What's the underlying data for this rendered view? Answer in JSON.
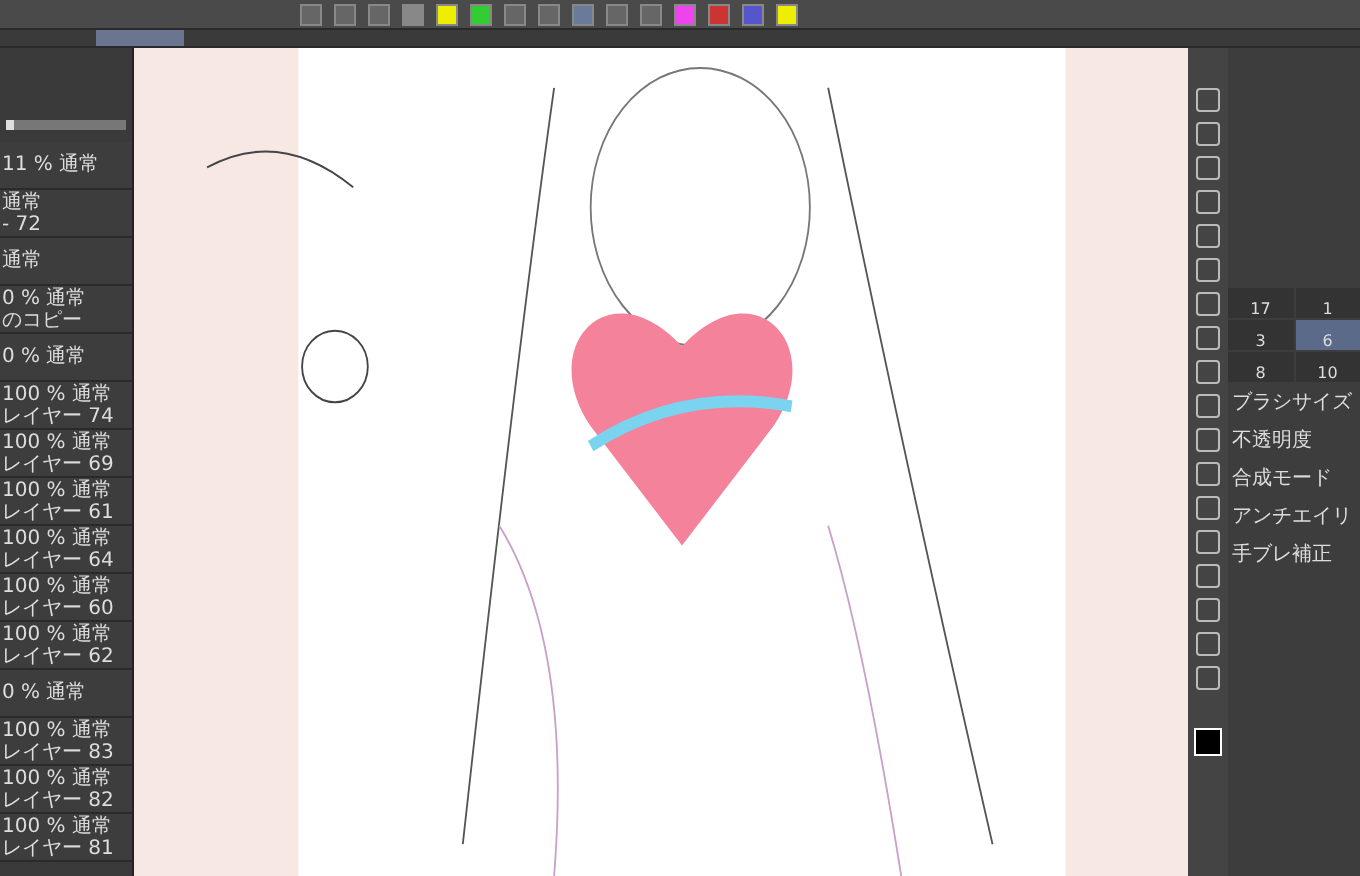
{
  "layer_panel": {
    "opacity_slider": {
      "level": 0.06
    },
    "layers": [
      {
        "line1": "11 % 通常",
        "selected": false
      },
      {
        "line1": "通常",
        "line2": "- 72",
        "selected": false
      },
      {
        "line1": "通常",
        "selected": false
      },
      {
        "line1": "0 % 通常",
        "line2": "のコピー",
        "selected": false
      },
      {
        "line1": "0 % 通常",
        "selected": false
      },
      {
        "line1": "100 % 通常",
        "line2": "レイヤー 74",
        "selected": false
      },
      {
        "line1": "100 % 通常",
        "line2": "レイヤー 69",
        "selected": false
      },
      {
        "line1": "100 % 通常",
        "line2": "レイヤー 61",
        "selected": false
      },
      {
        "line1": "100 % 通常",
        "line2": "レイヤー 64",
        "selected": false
      },
      {
        "line1": "100 % 通常",
        "line2": "レイヤー 60",
        "selected": false
      },
      {
        "line1": "100 % 通常",
        "line2": "レイヤー 62",
        "selected": false
      },
      {
        "line1": "0 % 通常",
        "selected": false
      },
      {
        "line1": "100 % 通常",
        "line2": "レイヤー 83",
        "selected": false
      },
      {
        "line1": "100 % 通常",
        "line2": "レイヤー 82",
        "selected": false
      },
      {
        "line1": "100 % 通常",
        "line2": "レイヤー 81",
        "selected": false
      }
    ]
  },
  "brush_sizes": [
    {
      "value": "17",
      "selected": false
    },
    {
      "value": "1",
      "selected": false
    },
    {
      "value": "3",
      "selected": false
    },
    {
      "value": "6",
      "selected": true
    },
    {
      "value": "8",
      "selected": false
    },
    {
      "value": "10",
      "selected": false
    }
  ],
  "tool_property": {
    "labels": [
      "ブラシサイズ",
      "不透明度",
      "合成モード",
      "アンチエイリ",
      "手ブレ補正"
    ]
  }
}
